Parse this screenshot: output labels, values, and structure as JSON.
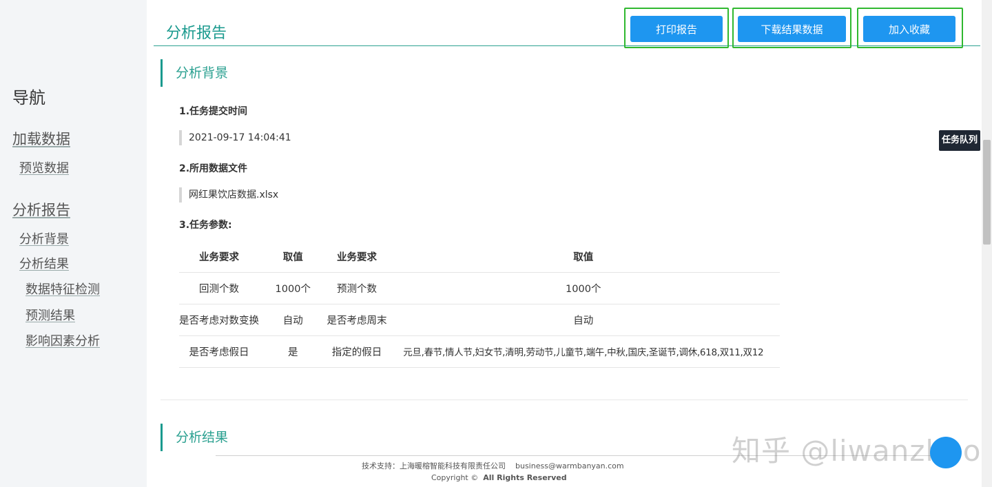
{
  "sidebar": {
    "title": "导航",
    "items": [
      {
        "label": "加载数据",
        "level": 1
      },
      {
        "label": "预览数据",
        "level": 2
      },
      {
        "label": "分析报告",
        "level": 1
      },
      {
        "label": "分析背景",
        "level": 2
      },
      {
        "label": "分析结果",
        "level": 2
      },
      {
        "label": "数据特征检测",
        "level": 3
      },
      {
        "label": "预测结果",
        "level": 3
      },
      {
        "label": "影响因素分析",
        "level": 3
      }
    ]
  },
  "header": {
    "title": "分析报告",
    "buttons": {
      "print": "打印报告",
      "download": "下载结果数据",
      "favorite": "加入收藏"
    }
  },
  "background": {
    "heading": "分析背景",
    "submit_time_label": "1.任务提交时间",
    "submit_time": "2021-09-17 14:04:41",
    "data_file_label": "2.所用数据文件",
    "data_file": "网红果饮店数据.xlsx",
    "params_label": "3.任务参数:",
    "params_table": {
      "headers": [
        "业务要求",
        "取值",
        "业务要求",
        "取值"
      ],
      "rows": [
        [
          "回测个数",
          "1000个",
          "预测个数",
          "1000个"
        ],
        [
          "是否考虑对数变换",
          "自动",
          "是否考虑周末",
          "自动"
        ],
        [
          "是否考虑假日",
          "是",
          "指定的假日",
          "元旦,春节,情人节,妇女节,清明,劳动节,儿童节,端午,中秋,国庆,圣诞节,调休,618,双11,双12"
        ]
      ]
    }
  },
  "results": {
    "heading": "分析结果"
  },
  "footer": {
    "support": "技术支持：上海暖榕智能科技有限责任公司",
    "email": "business@warmbanyan.com",
    "copyright": "Copyright ©",
    "rights": "All Rights Reserved"
  },
  "task_queue": "任务队列",
  "watermark": "知乎 @liwanzhao",
  "colors": {
    "accent": "#1a9a8e",
    "button": "#1e96f0",
    "highlight_border": "#2fb82f"
  }
}
